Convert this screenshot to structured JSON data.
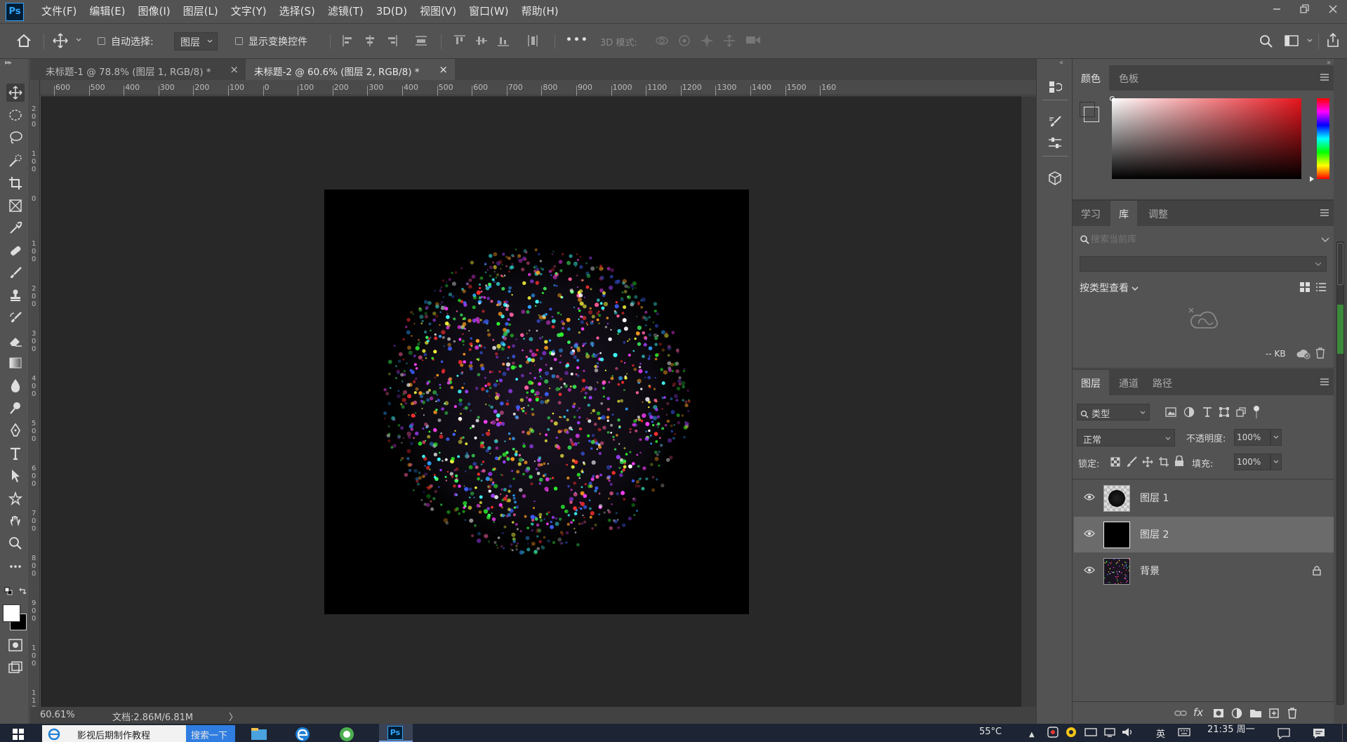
{
  "app": {
    "logo": "Ps"
  },
  "menu": [
    "文件(F)",
    "编辑(E)",
    "图像(I)",
    "图层(L)",
    "文字(Y)",
    "选择(S)",
    "滤镜(T)",
    "3D(D)",
    "视图(V)",
    "窗口(W)",
    "帮助(H)"
  ],
  "options": {
    "auto_select_label": "自动选择:",
    "auto_select_value": "图层",
    "show_transform_label": "显示变换控件",
    "mode_3d_label": "3D 模式:",
    "more_glyph": "•••"
  },
  "tabs": [
    {
      "label": "未标题-1 @ 78.8% (图层 1, RGB/8) *",
      "close": "×"
    },
    {
      "label": "未标题-2 @ 60.6% (图层 2, RGB/8) *",
      "close": "×"
    }
  ],
  "ruler_top": [
    "600",
    "500",
    "400",
    "300",
    "200",
    "100",
    "0",
    "100",
    "200",
    "300",
    "400",
    "500",
    "600",
    "700",
    "800",
    "900",
    "1000",
    "1100",
    "1200",
    "1300",
    "1400",
    "1500",
    "160"
  ],
  "ruler_left": [
    [
      "2",
      "0",
      "0"
    ],
    [
      "1",
      "0",
      "0"
    ],
    [
      "0"
    ],
    [
      "1",
      "0",
      "0"
    ],
    [
      "2",
      "0",
      "0"
    ],
    [
      "3",
      "0",
      "0"
    ],
    [
      "4",
      "0",
      "0"
    ],
    [
      "5",
      "0",
      "0"
    ],
    [
      "6",
      "0",
      "0"
    ],
    [
      "7",
      "0",
      "0"
    ],
    [
      "8",
      "0",
      "0"
    ],
    [
      "9",
      "0",
      "0"
    ],
    [
      "1",
      "0",
      "0"
    ],
    [
      "1",
      "1",
      "0"
    ]
  ],
  "status": {
    "zoom": "60.61%",
    "doc": "文档:2.86M/6.81M",
    "arrow": "〉"
  },
  "color_panel": {
    "tabs": [
      "颜色",
      "色板"
    ],
    "foreground": "#ffffff",
    "background": "#000000"
  },
  "library_panel": {
    "tabs": [
      "学习",
      "库",
      "调整"
    ],
    "search_placeholder": "搜索当前库",
    "view_label": "按类型查看",
    "size": "-- KB"
  },
  "layers_panel": {
    "tabs": [
      "图层",
      "通道",
      "路径"
    ],
    "filter": "类型",
    "blend": "正常",
    "opacity_label": "不透明度:",
    "opacity": "100%",
    "lock_label": "锁定:",
    "fill_label": "填充:",
    "fill": "100%",
    "layers": [
      {
        "name": "图层 1",
        "selected": false
      },
      {
        "name": "图层 2",
        "selected": true
      },
      {
        "name": "背景",
        "selected": false,
        "locked": true
      }
    ]
  },
  "taskbar": {
    "search_text": "影视后期制作教程",
    "search_button": "搜索一下",
    "temp": "55°C",
    "ime": "英",
    "clock": "21:35 周一"
  }
}
